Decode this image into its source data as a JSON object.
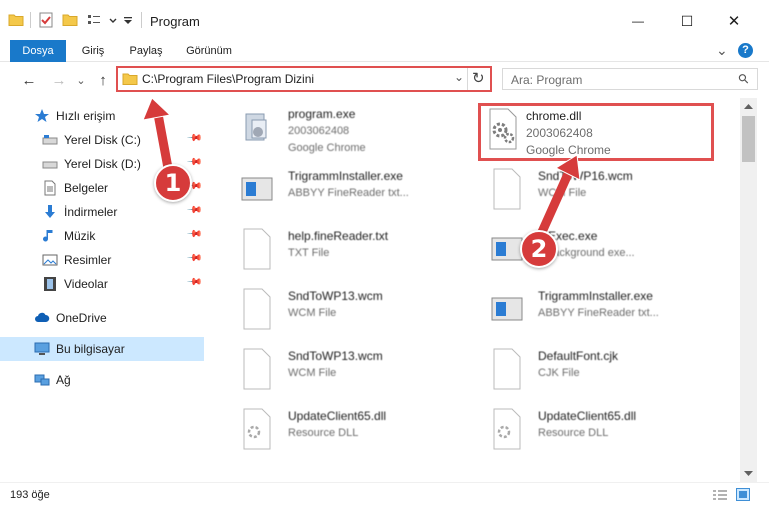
{
  "window": {
    "title": "Program",
    "minimize_glyph": "—",
    "maximize_glyph": "☐",
    "close_glyph": "✕"
  },
  "ribbon": {
    "tabs": [
      "Dosya",
      "Giriş",
      "Paylaş",
      "Görünüm"
    ],
    "active_tab": "Dosya",
    "collapse_glyph": "⌄",
    "help_glyph": "?"
  },
  "nav": {
    "back_glyph": "←",
    "forward_glyph": "→",
    "recent_glyph": "⌄",
    "up_glyph": "↑",
    "address": "C:\\Program Files\\Program Dizini",
    "address_dropdown_glyph": "⌄",
    "refresh_glyph": "↻",
    "search_placeholder": "Ara: Program",
    "search_glyph": "⚲"
  },
  "sidebar": {
    "pin_glyph": "📌",
    "items": [
      {
        "label": "Hızlı erişim",
        "icon": "star-icon",
        "pinned": false
      },
      {
        "label": "Yerel Disk (C:)",
        "icon": "drive-icon",
        "pinned": true
      },
      {
        "label": "Yerel Disk (D:)",
        "icon": "drive-icon",
        "pinned": true
      },
      {
        "label": "Belgeler",
        "icon": "document-icon",
        "pinned": true
      },
      {
        "label": "İndirmeler",
        "icon": "download-icon",
        "pinned": true
      },
      {
        "label": "Müzik",
        "icon": "music-icon",
        "pinned": true
      },
      {
        "label": "Resimler",
        "icon": "pictures-icon",
        "pinned": true
      },
      {
        "label": "Videolar",
        "icon": "video-icon",
        "pinned": true
      },
      {
        "label": "OneDrive",
        "icon": "cloud-icon",
        "pinned": false
      },
      {
        "label": "Bu bilgisayar",
        "icon": "computer-icon",
        "pinned": false,
        "selected": true
      },
      {
        "label": "Ağ",
        "icon": "network-icon",
        "pinned": false
      }
    ]
  },
  "files": [
    {
      "name": "program.exe",
      "line2": "2003062408",
      "line3": "Google Chrome",
      "icon": "exe-icon"
    },
    {
      "name": "chrome.dll",
      "line2": "2003062408",
      "line3": "Google Chrome",
      "icon": "dll-gear-icon",
      "highlighted": true
    },
    {
      "name": "TrigrammInstaller.exe",
      "line2": "ABBYY FineReader txt...",
      "line3": "",
      "icon": "installer-icon"
    },
    {
      "name": "SndToWP16.wcm",
      "line2": "WCM File",
      "line3": "",
      "icon": "blank-file-icon"
    },
    {
      "name": "help.fineReader.txt",
      "line2": "TXT File",
      "line3": "",
      "icon": "blank-file-icon"
    },
    {
      "name": "...Exec.exe",
      "line2": "...background exe...",
      "line3": "",
      "icon": "installer-icon"
    },
    {
      "name": "SndToWP13.wcm",
      "line2": "WCM File",
      "line3": "",
      "icon": "blank-file-icon"
    },
    {
      "name": "TrigrammInstaller.exe",
      "line2": "ABBYY FineReader txt...",
      "line3": "",
      "icon": "installer-icon"
    },
    {
      "name": "SndToWP13.wcm",
      "line2": "WCM File",
      "line3": "",
      "icon": "blank-file-icon"
    },
    {
      "name": "DefaultFont.cjk",
      "line2": "CJK File",
      "line3": "",
      "icon": "blank-file-icon"
    },
    {
      "name": "UpdateClient65.dll",
      "line2": "Resource DLL",
      "line3": "",
      "icon": "dll-gear-icon"
    },
    {
      "name": "UpdateClient65.dll",
      "line2": "Resource DLL",
      "line3": "",
      "icon": "dll-gear-icon"
    }
  ],
  "status": {
    "item_count": "193 öğe"
  },
  "callouts": [
    "1",
    "2"
  ],
  "colors": {
    "accent": "#1979ca",
    "highlight_red": "#e05050",
    "selected_bg": "#cce8ff",
    "callout_red": "#d63b3b"
  }
}
